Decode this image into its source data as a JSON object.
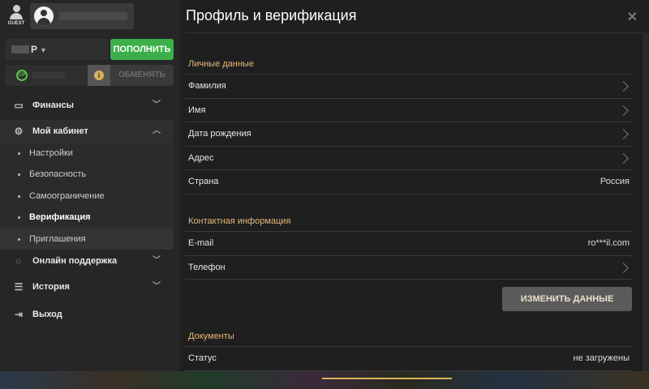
{
  "sidebar": {
    "guest_label": "GUEST",
    "balance_currency": "P",
    "deposit_label": "ПОПОЛНИТЬ",
    "cp_icon_text": "CP",
    "info_icon_text": "i",
    "exchange_label": "ОБМЕНЯТЬ",
    "menu": {
      "finance": "Финансы",
      "cabinet": "Мой кабинет",
      "cabinet_items": [
        "Настройки",
        "Безопасность",
        "Самоограничение",
        "Верификация",
        "Приглашения"
      ],
      "support": "Онлайн поддержка",
      "history": "История",
      "logout": "Выход"
    }
  },
  "modal": {
    "title": "Профиль и верификация",
    "close_glyph": "✕",
    "personal": {
      "heading": "Личные данные",
      "rows": {
        "surname": "Фамилия",
        "name": "Имя",
        "birthdate": "Дата рождения",
        "address": "Адрес",
        "country_label": "Страна",
        "country_value": "Россия"
      }
    },
    "contact": {
      "heading": "Контактная информация",
      "email_label": "E-mail",
      "email_value": "ro***il.com",
      "phone_label": "Телефон"
    },
    "change_button": "ИЗМЕНИТЬ ДАННЫЕ",
    "documents": {
      "heading": "Документы",
      "status_label": "Статус",
      "status_value": "не загружены"
    }
  },
  "colors": {
    "accent_green": "#3cae4a",
    "section_heading": "#e4b97a",
    "gold": "#d9b45e"
  }
}
